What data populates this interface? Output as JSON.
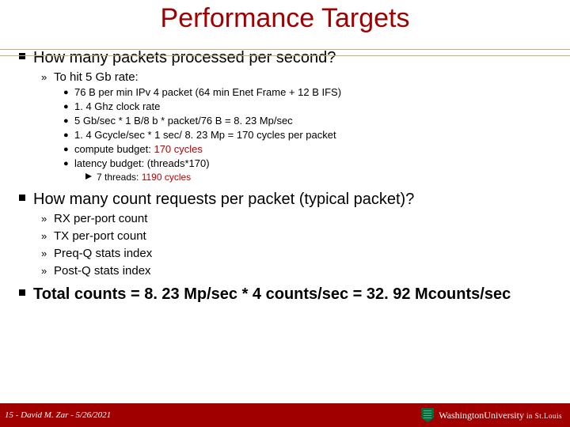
{
  "title": "Performance Targets",
  "q1": "How many packets processed per second?",
  "q1_sub": "To hit 5 Gb rate:",
  "pts": {
    "a": "76 B per min IPv 4 packet (64 min Enet Frame + 12 B IFS)",
    "b": "1. 4 Ghz clock rate",
    "c": "5 Gb/sec * 1 B/8 b * packet/76 B = 8. 23 Mp/sec",
    "d": "1. 4 Gcycle/sec * 1 sec/ 8. 23 Mp =  170 cycles per packet",
    "e_pre": "compute budget: ",
    "e_red": "170 cycles",
    "f": "latency budget: (threads*170)",
    "g_pre": "7 threads: ",
    "g_red": "1190 cycles"
  },
  "q2": "How many count requests per packet (typical packet)?",
  "q2_items": {
    "a": "RX per-port count",
    "b": "TX per-port count",
    "c": "Preq-Q stats index",
    "d": "Post-Q stats index"
  },
  "total": "Total counts = 8. 23 Mp/sec * 4 counts/sec = 32. 92 Mcounts/sec",
  "footer": {
    "left": "15 - David M. Zar - 5/26/2021",
    "uni": "WashingtonUniversity",
    "uni2": "in St.Louis"
  }
}
